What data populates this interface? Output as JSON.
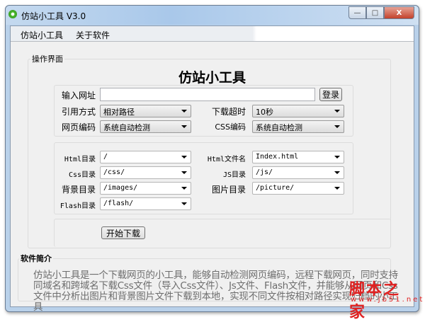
{
  "window": {
    "title": "仿站小工具 V3.0",
    "min": "—",
    "max": "□",
    "close": "X"
  },
  "menu": [
    "仿站小工具",
    "关于软件"
  ],
  "main": {
    "group_label": "操作界面",
    "heading": "仿站小工具",
    "url": {
      "label": "输入网址",
      "value": "",
      "login": "登录"
    },
    "ref_mode": {
      "label": "引用方式",
      "value": "相对路径"
    },
    "timeout": {
      "label": "下载超时",
      "value": "10秒"
    },
    "page_enc": {
      "label": "网页编码",
      "value": "系统自动检测"
    },
    "css_enc": {
      "label": "CSS编码",
      "value": "系统自动检测"
    },
    "html_dir": {
      "label": "Html目录",
      "value": "/"
    },
    "html_name": {
      "label": "Html文件名",
      "value": "Index.html"
    },
    "css_dir": {
      "label": "Css目录",
      "value": "/css/"
    },
    "js_dir": {
      "label": "JS目录",
      "value": "/js/"
    },
    "bg_dir": {
      "label": "背景目录",
      "value": "/images/"
    },
    "pic_dir": {
      "label": "图片目录",
      "value": "/picture/"
    },
    "flash_dir": {
      "label": "Flash目录",
      "value": "/flash/"
    },
    "start": "开始下载"
  },
  "intro": {
    "label": "软件简介",
    "text": "仿站小工具是一个下载网页的小工具，能够自动检测网页编码，远程下载网页，同时支持同域名和跨域名下载Css文件（导入Css文件）、Js文件、Flash文件，并能够从网页和Css文件中分析出图片和背景图片文件下载到本地，实现不同文件按相对路径实现归档的小工具"
  },
  "watermark": {
    "name": "脚本之家",
    "url": "www.jb51.net"
  }
}
